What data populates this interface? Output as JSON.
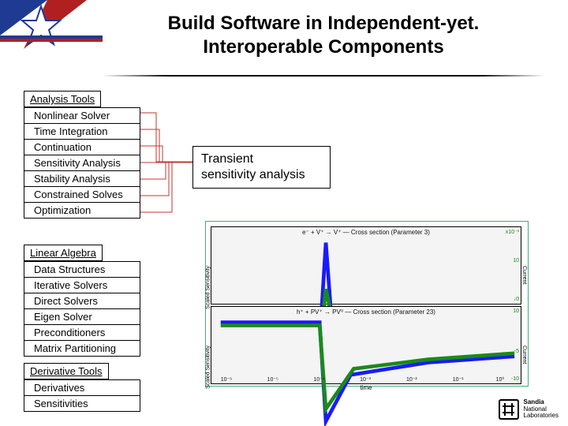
{
  "title": {
    "l1": "Build Software in Independent-yet.",
    "l2": "Interoperable Components"
  },
  "groups": {
    "analysis": {
      "header": "Analysis Tools",
      "items": [
        "Nonlinear Solver",
        "Time Integration",
        "Continuation",
        "Sensitivity Analysis",
        "Stability Analysis",
        "Constrained Solves",
        "Optimization"
      ]
    },
    "linalg": {
      "header": "Linear Algebra",
      "items": [
        "Data Structures",
        "Iterative Solvers",
        "Direct Solvers",
        "Eigen Solver",
        "Preconditioners",
        "Matrix Partitioning"
      ]
    },
    "deriv": {
      "header": "Derivative Tools",
      "items": [
        "Derivatives",
        "Sensitivities"
      ]
    }
  },
  "callout": {
    "l1": "Transient",
    "l2": "sensitivity analysis"
  },
  "footer": {
    "org1": "Sandia",
    "org2": "National",
    "org3": "Laboratories"
  },
  "chart_data": [
    {
      "type": "line",
      "title": "e⁻ + V⁺ → V⁺ — Cross section (Parameter 3)",
      "xlabel": "time",
      "ylabel": "Scaled Sensitivity",
      "ylabel_right": "Current",
      "ylim_right": [
        0,
        0.001
      ],
      "xscale": "log",
      "x": [
        1e-06,
        1e-05,
        8e-05,
        0.00015,
        0.0002,
        0.001,
        0.1,
        1
      ],
      "series": [
        {
          "name": "Scaled Sensitivity",
          "color": "#1a1aff",
          "values": [
            0.0,
            0.0,
            0.0,
            1.0,
            0.1,
            0.05,
            0.05,
            0.05
          ]
        },
        {
          "name": "Current",
          "color": "#1a8a1a",
          "values_right": [
            0.0,
            0.0,
            0.0,
            0.3,
            0.1,
            0.05,
            0.05,
            0.05
          ]
        }
      ],
      "yticks_right": [
        "x10⁻³",
        "10",
        "↓0"
      ]
    },
    {
      "type": "line",
      "title": "h⁺ + PV⁺ → PV⁰ — Cross section (Parameter 23)",
      "xlabel": "time",
      "ylabel": "Scaled Sensitivity",
      "ylabel_right": "Current",
      "ylim_right": [
        -10,
        10
      ],
      "xscale": "log",
      "x": [
        1e-06,
        1e-05,
        0.0001,
        0.00015,
        0.001,
        0.01,
        0.1,
        1
      ],
      "series": [
        {
          "name": "Scaled Sensitivity",
          "color": "#1a1aff",
          "values": [
            0.0,
            0.0,
            0.0,
            -1.0,
            -0.4,
            -0.3,
            -0.25,
            -0.2
          ]
        },
        {
          "name": "Current",
          "color": "#1a8a1a",
          "values_right": [
            0.0,
            0.0,
            0.0,
            -8.0,
            -4.0,
            -3.0,
            -2.5,
            -2.0
          ]
        }
      ],
      "yticks_right": [
        "10",
        "-5",
        "-10"
      ],
      "xticks": [
        "10⁻⁶",
        "10⁻⁵",
        "10⁻⁴",
        "10⁻³",
        "10⁻²",
        "10⁻¹",
        "10⁰"
      ]
    }
  ]
}
